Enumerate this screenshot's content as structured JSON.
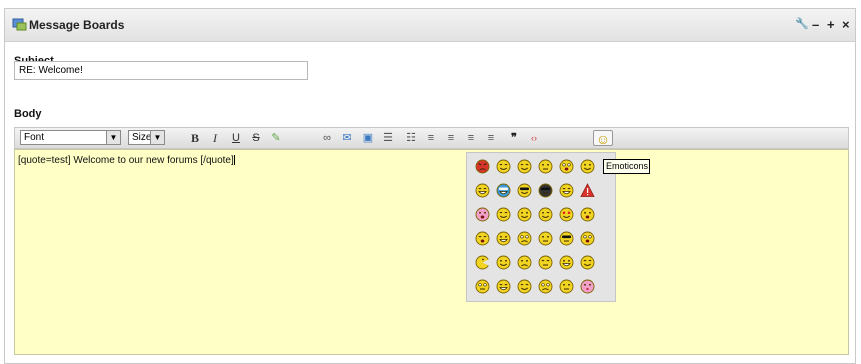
{
  "titlebar": {
    "title": "Message Boards",
    "controls": [
      {
        "name": "configure",
        "icon": "wrench-icon",
        "glyph": "🔧"
      },
      {
        "name": "minimize",
        "icon": "minus-icon",
        "glyph": "–"
      },
      {
        "name": "maximize",
        "icon": "plus-icon",
        "glyph": "+"
      },
      {
        "name": "close",
        "icon": "close-icon",
        "glyph": "×"
      }
    ]
  },
  "form": {
    "subject_label": "Subject",
    "subject_value": "RE: Welcome!",
    "body_label": "Body"
  },
  "toolbar": {
    "font_select": "Font",
    "size_select": "Size",
    "buttons": [
      {
        "name": "bold",
        "icon": "bold-icon",
        "glyph": "B"
      },
      {
        "name": "italic",
        "icon": "italic-icon",
        "glyph": "I"
      },
      {
        "name": "underline",
        "icon": "underline-icon",
        "glyph": "U"
      },
      {
        "name": "strikethrough",
        "icon": "strikethrough-icon",
        "glyph": "S"
      },
      {
        "name": "color",
        "icon": "text-color-icon",
        "glyph": "✎"
      },
      {
        "name": "link",
        "icon": "link-icon",
        "glyph": "∞"
      },
      {
        "name": "email",
        "icon": "email-icon",
        "glyph": "✉"
      },
      {
        "name": "image",
        "icon": "image-icon",
        "glyph": "▣"
      },
      {
        "name": "ordered-list",
        "icon": "ordered-list-icon",
        "glyph": "☰"
      },
      {
        "name": "unordered-list",
        "icon": "unordered-list-icon",
        "glyph": "☷"
      },
      {
        "name": "align-left",
        "icon": "align-left-icon",
        "glyph": "≡"
      },
      {
        "name": "align-center",
        "icon": "align-center-icon",
        "glyph": "≡"
      },
      {
        "name": "align-right",
        "icon": "align-right-icon",
        "glyph": "≡"
      },
      {
        "name": "justify",
        "icon": "justify-icon",
        "glyph": "≡"
      },
      {
        "name": "quote",
        "icon": "quote-icon",
        "glyph": "❞"
      },
      {
        "name": "code",
        "icon": "code-icon",
        "glyph": "‹›"
      },
      {
        "name": "emoticons",
        "icon": "smiley-icon",
        "glyph": "☺"
      }
    ]
  },
  "editor": {
    "content": "[quote=test] Welcome to our new forums [/quote]"
  },
  "emoticons": {
    "tooltip": "Emoticons",
    "items": [
      {
        "icon": "angry-face-icon",
        "color": "#d9342b",
        "mouth": "frown",
        "eyes": "angry"
      },
      {
        "icon": "squint-smile-icon",
        "color": "#f2d422",
        "mouth": "smile",
        "eyes": "closed"
      },
      {
        "icon": "blush-smile-icon",
        "color": "#f2d422",
        "mouth": "smile",
        "eyes": "happy"
      },
      {
        "icon": "neutral-face-icon",
        "color": "#f2d422",
        "mouth": "flat",
        "eyes": "dots"
      },
      {
        "icon": "dizzy-face-icon",
        "color": "#f2d422",
        "mouth": "open",
        "eyes": "wide"
      },
      {
        "icon": "cool-face-icon",
        "color": "#f2d422",
        "mouth": "smile",
        "eyes": "dots"
      },
      {
        "icon": "happy-face-icon",
        "color": "#f2d422",
        "mouth": "grin",
        "eyes": "closed"
      },
      {
        "icon": "glasses-face-icon",
        "color": "#3a9ad9",
        "mouth": "grin",
        "eyes": "glasses"
      },
      {
        "icon": "sunglasses-face-icon",
        "color": "#f2d422",
        "mouth": "smile",
        "eyes": "shades"
      },
      {
        "icon": "darth-vader-icon",
        "color": "#333333",
        "mouth": "flat",
        "eyes": "shades"
      },
      {
        "icon": "grin-face-icon",
        "color": "#f2d422",
        "mouth": "grin",
        "eyes": "closed"
      },
      {
        "icon": "warning-icon",
        "color": "#d9342b",
        "mouth": "none",
        "eyes": "none"
      },
      {
        "icon": "tongue-face-icon",
        "color": "#f2a0c8",
        "mouth": "open",
        "eyes": "dots"
      },
      {
        "icon": "innocent-face-icon",
        "color": "#f2d422",
        "mouth": "smile",
        "eyes": "closed"
      },
      {
        "icon": "smile-face-icon",
        "color": "#f2d422",
        "mouth": "smile",
        "eyes": "dots"
      },
      {
        "icon": "wink-face-icon",
        "color": "#f2d422",
        "mouth": "smile",
        "eyes": "wink"
      },
      {
        "icon": "love-eyes-icon",
        "color": "#f2d422",
        "mouth": "smile",
        "eyes": "hearts"
      },
      {
        "icon": "surprised-face-icon",
        "color": "#f2d422",
        "mouth": "open",
        "eyes": "dots"
      },
      {
        "icon": "laughing-face-icon",
        "color": "#f2d422",
        "mouth": "open",
        "eyes": "closed"
      },
      {
        "icon": "big-grin-icon",
        "color": "#f2d422",
        "mouth": "grin",
        "eyes": "dots"
      },
      {
        "icon": "confused-face-icon",
        "color": "#f2d422",
        "mouth": "frown",
        "eyes": "wide"
      },
      {
        "icon": "blank-face-icon",
        "color": "#f2d422",
        "mouth": "flat",
        "eyes": "dots"
      },
      {
        "icon": "ninja-face-icon",
        "color": "#f2d422",
        "mouth": "flat",
        "eyes": "band"
      },
      {
        "icon": "shocked-face-icon",
        "color": "#f2d422",
        "mouth": "open",
        "eyes": "wide"
      },
      {
        "icon": "pacman-face-icon",
        "color": "#f2d422",
        "mouth": "pac",
        "eyes": "dot1"
      },
      {
        "icon": "calm-face-icon",
        "color": "#f2d422",
        "mouth": "smile",
        "eyes": "dots"
      },
      {
        "icon": "worried-face-icon",
        "color": "#f2d422",
        "mouth": "frown",
        "eyes": "dots"
      },
      {
        "icon": "sleepy-face-icon",
        "color": "#f2d422",
        "mouth": "flat",
        "eyes": "closed"
      },
      {
        "icon": "teeth-grin-icon",
        "color": "#f2d422",
        "mouth": "grin",
        "eyes": "dots"
      },
      {
        "icon": "smirk-face-icon",
        "color": "#f2d422",
        "mouth": "smile",
        "eyes": "closed"
      },
      {
        "icon": "bored-face-icon",
        "color": "#f2d422",
        "mouth": "flat",
        "eyes": "wide"
      },
      {
        "icon": "silly-face-icon",
        "color": "#f2d422",
        "mouth": "grin",
        "eyes": "closed"
      },
      {
        "icon": "content-face-icon",
        "color": "#f2d422",
        "mouth": "smile",
        "eyes": "closed"
      },
      {
        "icon": "sad-face-icon",
        "color": "#f2d422",
        "mouth": "frown",
        "eyes": "wide"
      },
      {
        "icon": "unsure-face-icon",
        "color": "#f2d422",
        "mouth": "flat",
        "eyes": "dots"
      },
      {
        "icon": "kiss-face-icon",
        "color": "#f2a0c8",
        "mouth": "kiss",
        "eyes": "dots"
      }
    ]
  }
}
